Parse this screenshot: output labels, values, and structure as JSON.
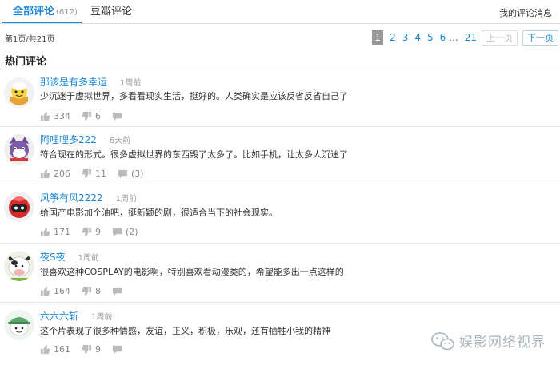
{
  "tabs": {
    "all_label": "全部评论",
    "all_count": "(612)",
    "douban_label": "豆瓣评论",
    "my_messages": "我的评论消息"
  },
  "pagination": {
    "info": "第1页/共21页",
    "pages": [
      "1",
      "2",
      "3",
      "4",
      "5",
      "6"
    ],
    "ellipsis": "...",
    "last_page": "21",
    "prev_label": "上一页",
    "next_label": "下一页"
  },
  "hot_title": "热门评论",
  "comments": [
    {
      "username": "那该是有多幸运",
      "time": "1周前",
      "text": "少沉迷于虚拟世界，多看看现实生活，挺好的。人类确实是应该反省反省自己了",
      "likes": "334",
      "dislikes": "6",
      "replies": "",
      "avatar_icon": "yellow-cartoon-avatar-icon"
    },
    {
      "username": "阿哩哩多222",
      "time": "6天前",
      "text": "符合现在的形式。很多虚拟世界的东西毁了太多了。比如手机，让太多人沉迷了",
      "likes": "206",
      "dislikes": "11",
      "replies": "(3)",
      "avatar_icon": "purple-cat-avatar-icon"
    },
    {
      "username": "风筝有风2222",
      "time": "1周前",
      "text": "给国产电影加个油吧，挺新颖的剧，很适合当下的社会现实。",
      "likes": "171",
      "dislikes": "9",
      "replies": "(2)",
      "avatar_icon": "red-helmet-avatar-icon"
    },
    {
      "username": "夜S夜",
      "time": "1周前",
      "text": "很喜欢这种COSPLAY的电影啊，特别喜欢看动漫类的，希望能多出一点这样的",
      "likes": "164",
      "dislikes": "8",
      "replies": "",
      "avatar_icon": "cow-avatar-icon"
    },
    {
      "username": "六六六斩",
      "time": "1周前",
      "text": "这个片表现了很多种情感，友谊，正义，积极，乐观，还有牺牲小我的精神",
      "likes": "161",
      "dislikes": "9",
      "replies": "",
      "avatar_icon": "green-hat-avatar-icon"
    }
  ],
  "watermark": {
    "text": "娱影网络视界",
    "icon": "wechat-icon"
  },
  "colors": {
    "accent": "#1a85d6",
    "muted": "#999999",
    "border": "#e6e6e6"
  }
}
